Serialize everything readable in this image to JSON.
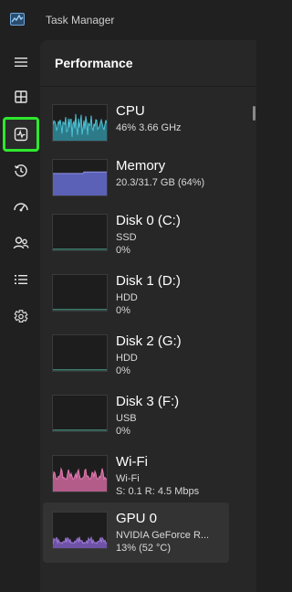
{
  "app": {
    "title": "Task Manager"
  },
  "page": {
    "header": "Performance"
  },
  "nav": [
    {
      "name": "hamburger-menu-icon"
    },
    {
      "name": "processes-icon"
    },
    {
      "name": "performance-icon"
    },
    {
      "name": "app-history-icon"
    },
    {
      "name": "startup-apps-icon"
    },
    {
      "name": "users-icon"
    },
    {
      "name": "details-icon"
    },
    {
      "name": "services-icon"
    }
  ],
  "items": [
    {
      "title": "CPU",
      "line1": "46%  3.66 GHz",
      "line2": "",
      "color": "#4cc2d6",
      "fill": "#2d7b89"
    },
    {
      "title": "Memory",
      "line1": "20.3/31.7 GB (64%)",
      "line2": "",
      "color": "#8f93e3",
      "fill": "#5c61b8"
    },
    {
      "title": "Disk 0 (C:)",
      "line1": "SSD",
      "line2": "0%",
      "color": "#52b39a",
      "fill": "#1d1d1d"
    },
    {
      "title": "Disk 1 (D:)",
      "line1": "HDD",
      "line2": "0%",
      "color": "#52b39a",
      "fill": "#1d1d1d"
    },
    {
      "title": "Disk 2 (G:)",
      "line1": "HDD",
      "line2": "0%",
      "color": "#52b39a",
      "fill": "#1d1d1d"
    },
    {
      "title": "Disk 3 (F:)",
      "line1": "USB",
      "line2": "0%",
      "color": "#52b39a",
      "fill": "#1d1d1d"
    },
    {
      "title": "Wi-Fi",
      "line1": "Wi-Fi",
      "line2": "S: 0.1  R: 4.5 Mbps",
      "color": "#e27bb1",
      "fill": "#b35c8a"
    },
    {
      "title": "GPU 0",
      "line1": "NVIDIA GeForce R...",
      "line2": "13%  (52 °C)",
      "color": "#9d78d6",
      "fill": "#6e52a6"
    }
  ]
}
